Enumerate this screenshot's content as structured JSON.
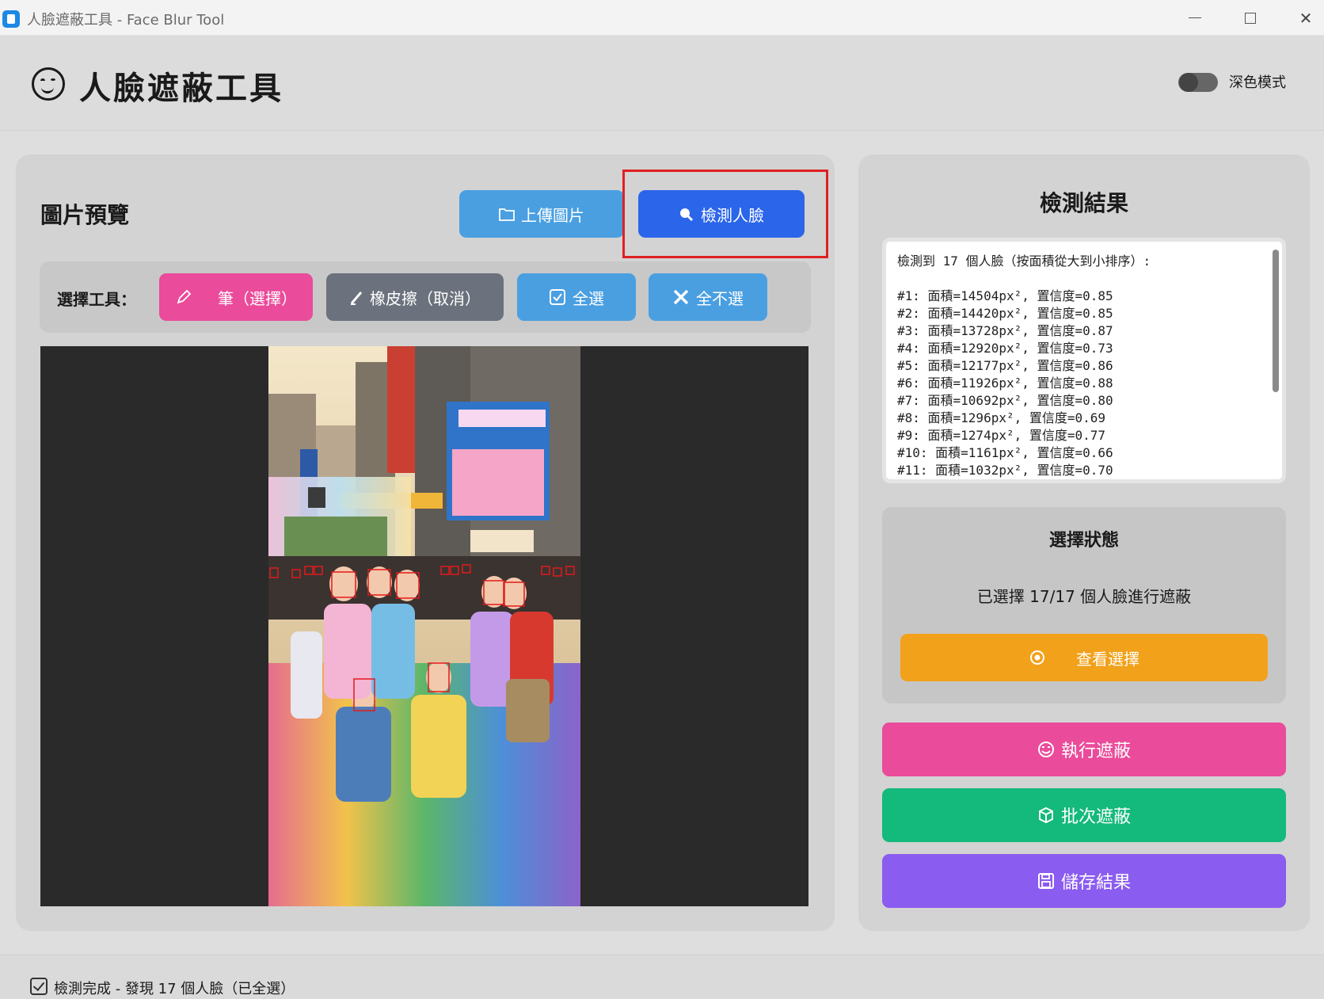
{
  "window": {
    "title": "人臉遮蔽工具 - Face Blur Tool"
  },
  "header": {
    "title": "人臉遮蔽工具",
    "dark_mode_label": "深色模式",
    "dark_mode_on": false
  },
  "preview": {
    "title": "圖片預覽",
    "upload_label": "上傳圖片",
    "detect_label": "檢測人臉"
  },
  "tools": {
    "label": "選擇工具：",
    "pen_label": "筆（選擇）",
    "eraser_label": "橡皮擦（取消）",
    "select_all_label": "全選",
    "select_none_label": "全不選"
  },
  "results": {
    "title": "檢測結果",
    "text": "檢測到 17 個人臉（按面積從大到小排序）:\n\n#1: 面積=14504px², 置信度=0.85\n#2: 面積=14420px², 置信度=0.85\n#3: 面積=13728px², 置信度=0.87\n#4: 面積=12920px², 置信度=0.73\n#5: 面積=12177px², 置信度=0.86\n#6: 面積=11926px², 置信度=0.88\n#7: 面積=10692px², 置信度=0.80\n#8: 面積=1296px², 置信度=0.69\n#9: 面積=1274px², 置信度=0.77\n#10: 面積=1161px², 置信度=0.66\n#11: 面積=1032px², 置信度=0.70"
  },
  "selection": {
    "title": "選擇狀態",
    "status": "已選擇 17/17 個人臉進行遮蔽",
    "view_label": "查看選擇"
  },
  "actions": {
    "blur_label": "執行遮蔽",
    "batch_label": "批次遮蔽",
    "save_label": "儲存結果"
  },
  "statusbar": {
    "message": "檢測完成 - 發現 17 個人臉（已全選）"
  },
  "colors": {
    "primary": "#2b65ea",
    "info": "#4a9fe1",
    "pink": "#ea4b9a",
    "gray": "#6b727d",
    "orange": "#f2a11a",
    "green": "#14b97c",
    "purple": "#8b5cf0",
    "highlight": "#e02020"
  }
}
